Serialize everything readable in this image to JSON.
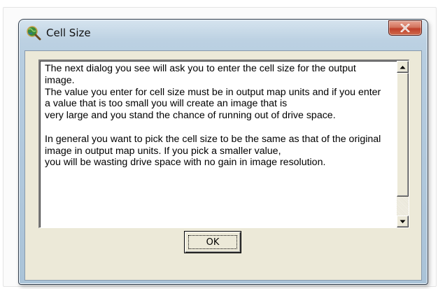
{
  "window": {
    "title": "Cell Size",
    "icon": "globe-magnifier-icon",
    "close_icon": "close-x-icon"
  },
  "message": {
    "paragraphs": [
      "The next dialog you see will ask you to enter the cell size for the output image.",
      "The value you enter for cell size must be in output map units and if you enter a value that is too small you will create an image that is",
      "very large and you stand the chance of running out of drive space.",
      "",
      "In general you want to pick the cell size to be the same as that of the original image in output map units. If you pick a smaller value,",
      "you will be wasting drive space with no gain in image resolution."
    ],
    "scroll_position": 0.85
  },
  "buttons": {
    "ok_label": "OK"
  },
  "colors": {
    "close_button": "#c0402a",
    "dialog_face": "#ece9d8",
    "frame": "#b7cde0"
  }
}
